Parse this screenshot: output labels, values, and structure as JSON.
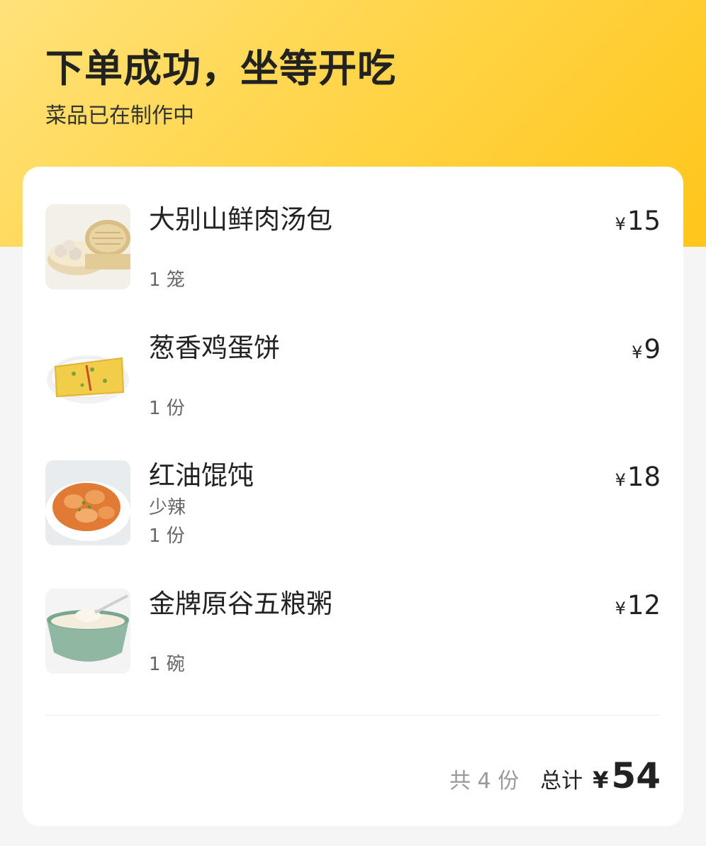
{
  "header": {
    "title": "下单成功，坐等开吃",
    "subtitle": "菜品已在制作中"
  },
  "order": {
    "currency_symbol": "¥",
    "items": [
      {
        "name": "大别山鲜肉汤包",
        "note": "",
        "qty": "1 笼",
        "price": "15",
        "icon": "soup-dumplings-steamer-image"
      },
      {
        "name": "葱香鸡蛋饼",
        "note": "",
        "qty": "1 份",
        "price": "9",
        "icon": "egg-pancake-image"
      },
      {
        "name": "红油馄饨",
        "note": "少辣",
        "qty": "1 份",
        "price": "18",
        "icon": "chili-oil-wonton-image"
      },
      {
        "name": "金牌原谷五粮粥",
        "note": "",
        "qty": "1 碗",
        "price": "12",
        "icon": "grain-porridge-bowl-image"
      }
    ],
    "summary": {
      "count_text": "共 4 份",
      "total_label": "总计",
      "total_amount": "54"
    }
  },
  "colors": {
    "header_gradient_start": "#ffe27a",
    "header_gradient_end": "#ffc61a",
    "text_primary": "#222222",
    "text_secondary": "#666666",
    "text_muted": "#999999"
  }
}
